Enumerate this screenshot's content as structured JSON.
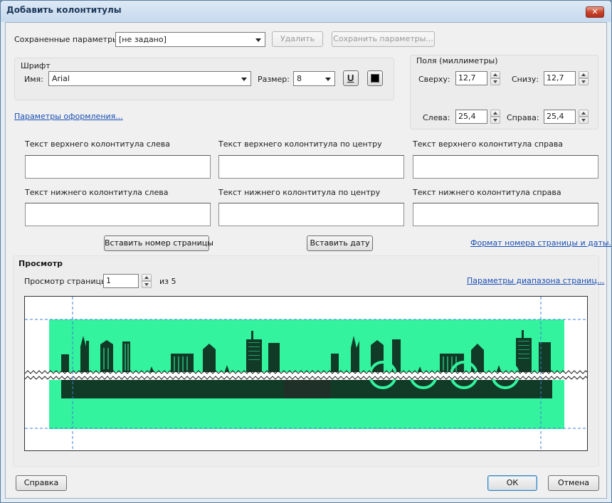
{
  "window": {
    "title": "Добавить колонтитулы",
    "close_label": "✕"
  },
  "saved": {
    "label": "Сохраненные параметры:",
    "value": "[не задано]",
    "delete_label": "Удалить",
    "save_label": "Сохранить параметры..."
  },
  "font": {
    "group_title": "Шрифт",
    "name_label": "Имя:",
    "name_value": "Arial",
    "size_label": "Размер:",
    "size_value": "8",
    "underline_glyph": "U"
  },
  "margins": {
    "group_title": "Поля (миллиметры)",
    "top_label": "Сверху:",
    "top_value": "12,7",
    "bottom_label": "Снизу:",
    "bottom_value": "12,7",
    "left_label": "Слева:",
    "left_value": "25,4",
    "right_label": "Справа:",
    "right_value": "25,4"
  },
  "format_link": "Параметры оформления...",
  "header_fields": {
    "left_label": "Текст верхнего колонтитула слева",
    "center_label": "Текст верхнего колонтитула по центру",
    "right_label": "Текст верхнего колонтитула справа"
  },
  "footer_fields": {
    "left_label": "Текст нижнего колонтитула слева",
    "center_label": "Текст нижнего колонтитула по центру",
    "right_label": "Текст нижнего колонтитула справа"
  },
  "actions": {
    "insert_page_label": "Вставить номер страницы",
    "insert_date_label": "Вставить дату",
    "page_date_format_link": "Формат номера страницы и даты..."
  },
  "preview": {
    "section_title": "Просмотр",
    "page_label": "Просмотр страницы",
    "page_value": "1",
    "page_total": "из 5",
    "range_link": "Параметры диапазона страниц..."
  },
  "footer_buttons": {
    "help_label": "Справка",
    "ok_label": "ОК",
    "cancel_label": "Отмена"
  },
  "colors": {
    "preview_green": "#33f39e",
    "skyline_dark": "#113b26",
    "link_blue": "#1a4fb5"
  }
}
